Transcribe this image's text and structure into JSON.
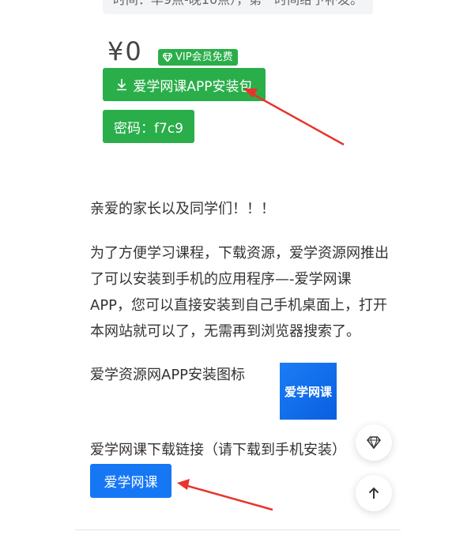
{
  "top_note": "时间：早9点-晚10点），第一时间给予补发。",
  "price": "¥0",
  "vip_badge": {
    "label": "VIP会员免费",
    "icon": "diamond-icon"
  },
  "download_button": {
    "label": "爱学网课APP安装包",
    "icon": "download-icon"
  },
  "password_button": {
    "label": "密码：f7c9"
  },
  "greeting": "亲爱的家长以及同学们！！！",
  "intro": "为了方便学习课程，下载资源，爱学资源网推出了可以安装到手机的应用程序—-爱学网课APP，您可以直接安装到自己手机桌面上，打开本网站就可以了，无需再到浏览器搜索了。",
  "icon_label": "爱学资源网APP安装图标",
  "app_icon_text": "爱学网课",
  "link_label": "爱学网课下载链接（请下载到手机安装）",
  "link_button": "爱学网课",
  "float_buttons": [
    "diamond-icon",
    "arrow-up-icon"
  ],
  "colors": {
    "green": "#2aae4a",
    "blue": "#1677f5",
    "arrow": "#e8342c"
  }
}
